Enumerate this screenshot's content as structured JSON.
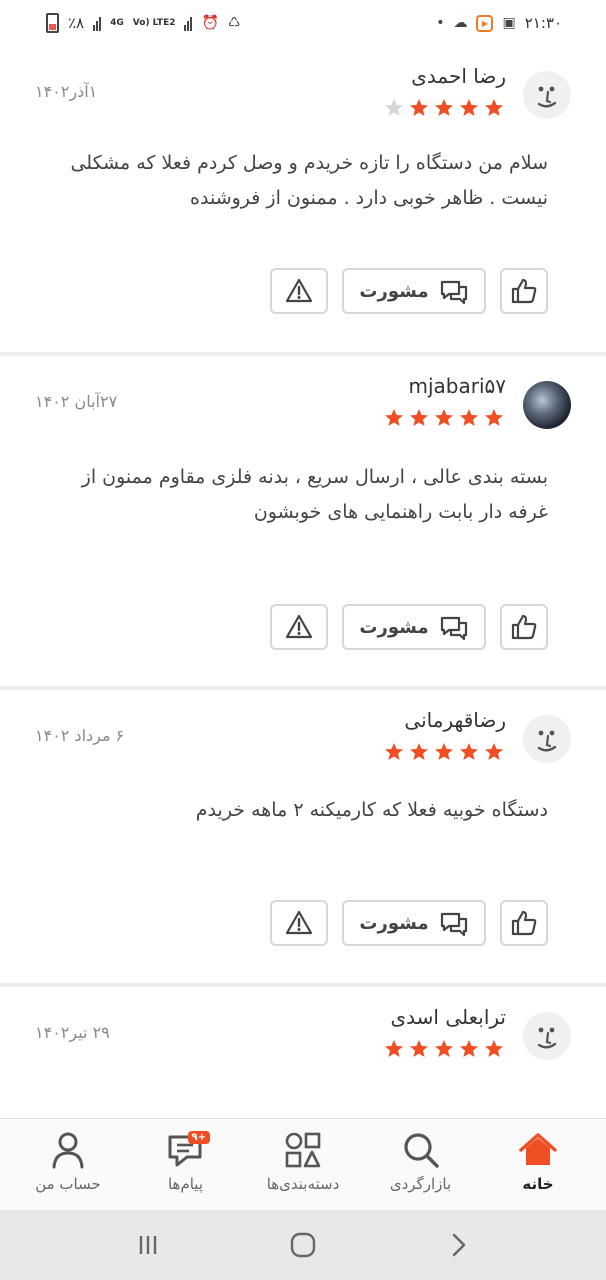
{
  "status_bar": {
    "battery_text": "٪۸",
    "network_4g": "4G",
    "network_lte": "Vo) LTE2",
    "time": "۲۱:۳۰",
    "colors": {
      "battery_low": "#e55555",
      "app_icon": "#f07b20"
    }
  },
  "theme": {
    "star_active": "#f04e23",
    "star_inactive": "#d6d6d6",
    "accent": "#f04e23"
  },
  "reviews": [
    {
      "name": "رضا احمدی",
      "date": "۱آذر۱۴۰۲",
      "rating": 4,
      "text": "سلام من دستگاه را تازه خریدم و وصل کردم فعلا که مشکلی نیست . ظاهر خوبی دارد . ممنون از فروشنده",
      "avatar": "smiley-avatar-icon",
      "consult_label": "مشورت"
    },
    {
      "name": "mjabari۵۷",
      "date": "۲۷آبان ۱۴۰۲",
      "rating": 5,
      "text": "بسته بندی عالی ، ارسال سریع ، بدنه فلزی مقاوم ممنون از غرفه دار بابت راهنمایی های خوبشون",
      "avatar": "photo-avatar",
      "consult_label": "مشورت"
    },
    {
      "name": "رضاقهرمانی",
      "date": "۶ مرداد ۱۴۰۲",
      "rating": 5,
      "text": "دستگاه خوبیه فعلا که کارمیکنه ۲ ماهه خریدم",
      "avatar": "smiley-avatar-icon",
      "consult_label": "مشورت"
    },
    {
      "name": "ترابعلی اسدی",
      "date": "۲۹ تیر۱۴۰۲",
      "rating": 5,
      "text": "",
      "avatar": "smiley-avatar-icon"
    }
  ],
  "tabbar": {
    "home": "خانه",
    "explore": "بازارگردی",
    "categories": "دسته‌بندی‌ها",
    "messages": "پیام‌ها",
    "messages_badge": "۹+",
    "account": "حساب من"
  },
  "navbar": {
    "recents": "recents-icon",
    "home": "home-circle-icon",
    "back": "back-chevron-icon"
  }
}
